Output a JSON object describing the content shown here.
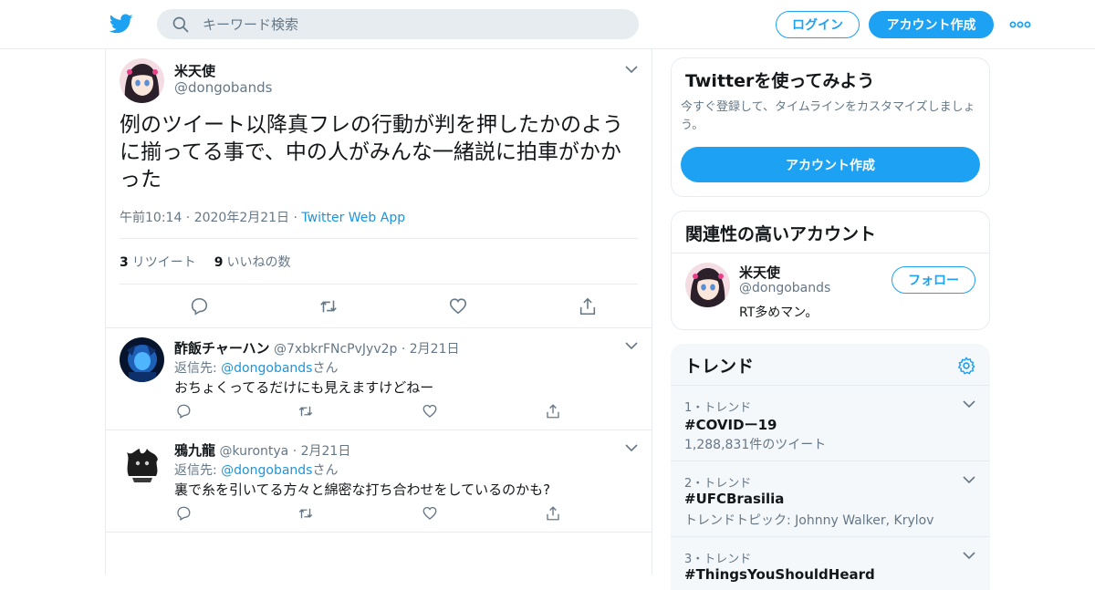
{
  "header": {
    "search_placeholder": "キーワード検索",
    "login_label": "ログイン",
    "signup_label": "アカウント作成"
  },
  "colors": {
    "accent": "#1da1f2",
    "link": "#1b95e0",
    "muted": "#657786"
  },
  "tweet": {
    "name": "米天使",
    "handle": "@dongobands",
    "text": "例のツイート以降真フレの行動が判を押したかのように揃ってる事で、中の人がみんな一緒説に拍車がかかった",
    "time": "午前10:14 · 2020年2月21日 · ",
    "source": "Twitter Web App",
    "retweets_count": "3",
    "retweets_label": "リツイート",
    "likes_count": "9",
    "likes_label": "いいねの数"
  },
  "replies": [
    {
      "name": "酢飯チャーハン",
      "handle_date": "@7xbkrFNcPvJyv2p · 2月21日",
      "reply_to_prefix": "返信先: ",
      "reply_to_handle": "@dongobands",
      "reply_to_suffix": "さん",
      "text": "おちょくってるだけにも見えますけどねー"
    },
    {
      "name": "鴉九龍",
      "handle_date": "@kurontya · 2月21日",
      "reply_to_prefix": "返信先: ",
      "reply_to_handle": "@dongobands",
      "reply_to_suffix": "さん",
      "text": "裏で糸を引いてる方々と綿密な打ち合わせをしているのかも?"
    }
  ],
  "sidebar": {
    "try": {
      "title": "Twitterを使ってみよう",
      "desc": "今すぐ登録して、タイムラインをカスタマイズしましょう。",
      "button": "アカウント作成"
    },
    "related": {
      "title": "関連性の高いアカウント",
      "name": "米天使",
      "handle": "@dongobands",
      "bio": "RT多めマン。",
      "follow": "フォロー"
    },
    "trends": {
      "title": "トレンド",
      "items": [
        {
          "meta": "1・トレンド",
          "tag": "#COVIDー19",
          "sub": "1,288,831件のツイート"
        },
        {
          "meta": "2・トレンド",
          "tag": "#UFCBrasilia",
          "sub": "トレンドトピック: Johnny Walker, Krylov"
        },
        {
          "meta": "3・トレンド",
          "tag": "#ThingsYouShouldHeard",
          "sub": ""
        }
      ]
    }
  }
}
